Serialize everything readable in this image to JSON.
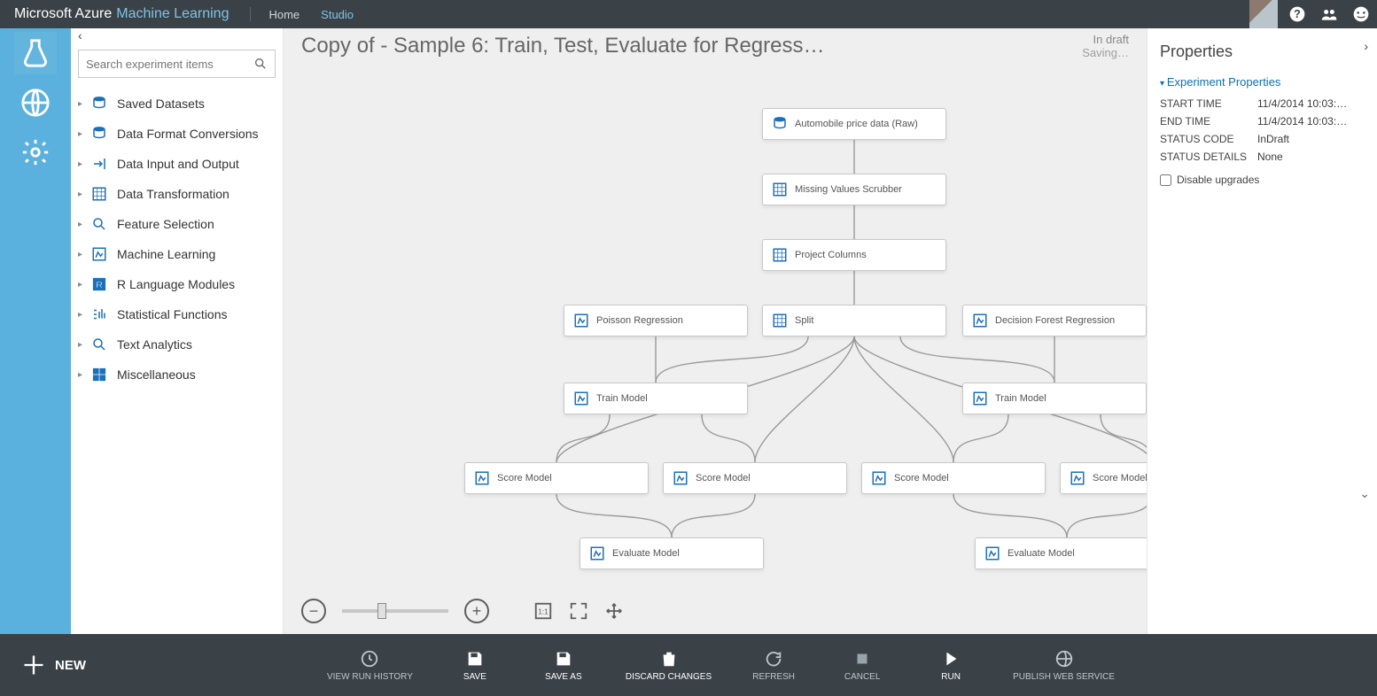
{
  "brand": {
    "a": "Microsoft Azure",
    "b": "Machine Learning"
  },
  "nav": {
    "home": "Home",
    "studio": "Studio"
  },
  "search": {
    "placeholder": "Search experiment items"
  },
  "palette": [
    {
      "label": "Saved Datasets",
      "icon": "db"
    },
    {
      "label": "Data Format Conversions",
      "icon": "db"
    },
    {
      "label": "Data Input and Output",
      "icon": "io"
    },
    {
      "label": "Data Transformation",
      "icon": "grid"
    },
    {
      "label": "Feature Selection",
      "icon": "lens"
    },
    {
      "label": "Machine Learning",
      "icon": "ml"
    },
    {
      "label": "R Language Modules",
      "icon": "r"
    },
    {
      "label": "Statistical Functions",
      "icon": "stat"
    },
    {
      "label": "Text Analytics",
      "icon": "lens"
    },
    {
      "label": "Miscellaneous",
      "icon": "misc"
    }
  ],
  "experiment": {
    "title": "Copy of - Sample 6: Train, Test, Evaluate for Regress…",
    "status": "In draft",
    "saving": "Saving…"
  },
  "nodes": {
    "data": {
      "label": "Automobile price data (Raw)",
      "icon": "db"
    },
    "miss": {
      "label": "Missing Values Scrubber",
      "icon": "grid"
    },
    "proj": {
      "label": "Project Columns",
      "icon": "grid"
    },
    "pois": {
      "label": "Poisson Regression",
      "icon": "ml"
    },
    "split": {
      "label": "Split",
      "icon": "grid"
    },
    "dfr": {
      "label": "Decision Forest Regression",
      "icon": "ml"
    },
    "trainL": {
      "label": "Train Model",
      "icon": "ml"
    },
    "trainR": {
      "label": "Train Model",
      "icon": "ml"
    },
    "sc1": {
      "label": "Score Model",
      "icon": "ml"
    },
    "sc2": {
      "label": "Score Model",
      "icon": "ml"
    },
    "sc3": {
      "label": "Score Model",
      "icon": "ml"
    },
    "sc4": {
      "label": "Score Model",
      "icon": "ml"
    },
    "evL": {
      "label": "Evaluate Model",
      "icon": "ml"
    },
    "evR": {
      "label": "Evaluate Model",
      "icon": "ml"
    }
  },
  "props": {
    "title": "Properties",
    "section": "Experiment Properties",
    "rows": {
      "start": {
        "k": "START TIME",
        "v": "11/4/2014 10:03:…"
      },
      "end": {
        "k": "END TIME",
        "v": "11/4/2014 10:03:…"
      },
      "code": {
        "k": "STATUS CODE",
        "v": "InDraft"
      },
      "detail": {
        "k": "STATUS DETAILS",
        "v": "None"
      }
    },
    "disable": "Disable upgrades"
  },
  "bottom": {
    "new": "NEW",
    "history": "VIEW RUN HISTORY",
    "save": "SAVE",
    "saveas": "SAVE AS",
    "discard": "DISCARD CHANGES",
    "refresh": "REFRESH",
    "cancel": "CANCEL",
    "run": "RUN",
    "publish": "PUBLISH WEB SERVICE"
  }
}
